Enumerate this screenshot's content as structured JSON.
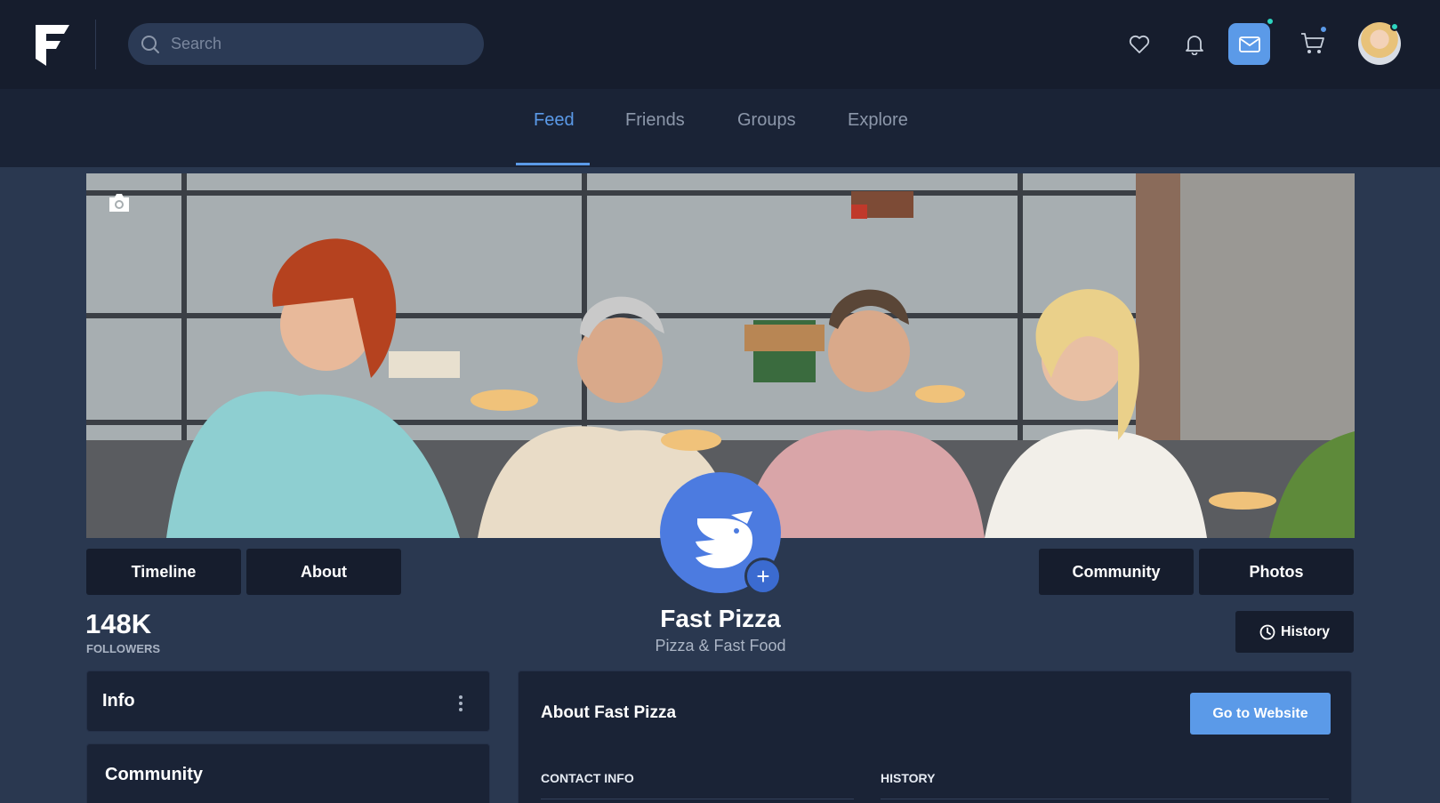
{
  "header": {
    "search_placeholder": "Search",
    "icons": [
      "heart-icon",
      "bell-icon",
      "mail-icon",
      "cart-icon"
    ],
    "accent_color": "#5b9ae8"
  },
  "nav": {
    "tabs": [
      {
        "label": "Feed",
        "active": true
      },
      {
        "label": "Friends",
        "active": false
      },
      {
        "label": "Groups",
        "active": false
      },
      {
        "label": "Explore",
        "active": false
      }
    ]
  },
  "profile": {
    "buttons_left": [
      "Timeline",
      "About"
    ],
    "buttons_right": [
      "Community",
      "Photos"
    ],
    "name": "Fast Pizza",
    "subtitle": "Pizza & Fast Food",
    "followers_count": "148K",
    "followers_label": "FOLLOWERS",
    "history_label": "History"
  },
  "sidebar": {
    "info_title": "Info",
    "community_title": "Community"
  },
  "about_panel": {
    "title": "About Fast Pizza",
    "website_button": "Go to Website",
    "contact_label": "CONTACT INFO",
    "history_label": "HISTORY"
  }
}
